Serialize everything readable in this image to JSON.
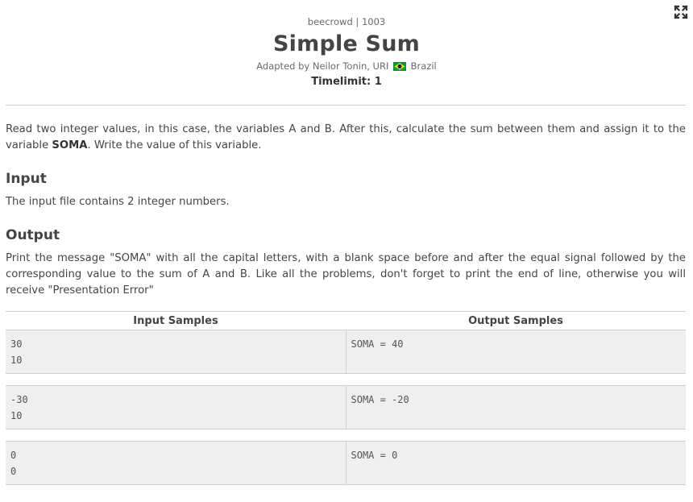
{
  "header": {
    "source": "beecrowd | 1003",
    "title": "Simple Sum",
    "adapted_prefix": "Adapted by Neilor Tonin, URI",
    "country": "Brazil",
    "timelimit": "Timelimit: 1"
  },
  "description": {
    "text_before": "Read two integer values, in this case, the variables A and B. After this, calculate the sum between them and assign it to the variable ",
    "highlight": "SOMA",
    "text_after": ". Write the value of this variable."
  },
  "input_section": {
    "heading": "Input",
    "text": "The input file contains 2 integer numbers."
  },
  "output_section": {
    "heading": "Output",
    "text": "Print the message \"SOMA\" with all the capital letters, with a blank space before and after the equal signal followed by the corresponding value to the sum of A and B. Like all the problems, don't forget to print the end of line, otherwise you will receive \"Presentation Error\""
  },
  "samples": {
    "input_header": "Input Samples",
    "output_header": "Output Samples",
    "rows": [
      {
        "input": [
          "30",
          "10"
        ],
        "output": [
          "SOMA = 40"
        ]
      },
      {
        "input": [
          "-30",
          "10"
        ],
        "output": [
          "SOMA = -20"
        ]
      },
      {
        "input": [
          "0",
          "0"
        ],
        "output": [
          "SOMA = 0"
        ]
      }
    ]
  },
  "icons": {
    "fullscreen": "fullscreen-icon",
    "flag": "brazil-flag-icon"
  },
  "colors": {
    "title": "#444444",
    "sample_bg": "#efefef",
    "border": "#cfcfcf",
    "flag_green": "#009c3b",
    "flag_yellow": "#ffdf00",
    "flag_blue": "#002776"
  }
}
